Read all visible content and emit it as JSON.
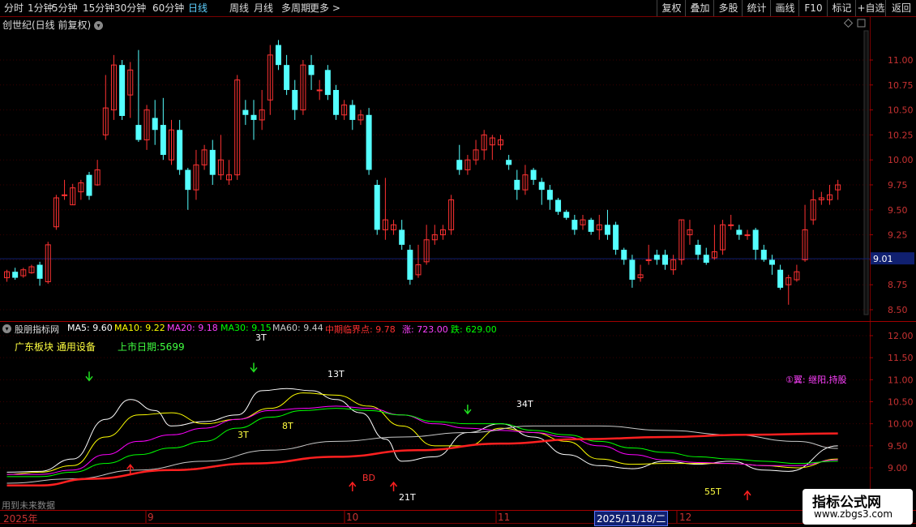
{
  "toolbar": {
    "periods": [
      "分时",
      "1分钟",
      "5分钟",
      "15分钟",
      "30分钟",
      "60分钟",
      "日线",
      "周线",
      "月线",
      "多周期",
      "更多 >"
    ],
    "active_index": 6,
    "right_buttons": [
      "复权",
      "叠加",
      "多股",
      "统计",
      "画线",
      "F10",
      "标记",
      "+自选",
      "返回"
    ]
  },
  "stock": {
    "name": "创世纪(日线 前复权)",
    "toggle_icon": "chevron-down-icon"
  },
  "price_axis": {
    "labels": [
      "11.00",
      "10.75",
      "10.50",
      "10.25",
      "10.00",
      "9.75",
      "9.50",
      "9.25",
      "9.00",
      "8.75",
      "8.50"
    ],
    "current": "9.01"
  },
  "indicator_axis": {
    "labels": [
      "12.00",
      "11.50",
      "11.00",
      "10.50",
      "10.00",
      "9.50",
      "9.00"
    ]
  },
  "indicator": {
    "name": "股朋指标网",
    "ma5": "MA5: 9.60",
    "ma10": "MA10: 9.22",
    "ma20": "MA20: 9.18",
    "ma30": "MA30: 9.15",
    "ma60": "MA60: 9.44",
    "critical": "中期临界点: 9.78",
    "up": "涨: 723.00",
    "down": "跌: 629.00"
  },
  "info": {
    "sector": "广东板块  通用设备",
    "ipo": "上市日期:5699",
    "signal": "①翼: 继阳,持股"
  },
  "chart_labels": {
    "t3a": "3T",
    "t8": "8T",
    "t13": "13T",
    "t34": "34T",
    "t55": "55T",
    "t21": "21T",
    "bd": "BD",
    "t3b": "3T"
  },
  "bottom_note": "用到未来数据",
  "date_axis": {
    "year": "2025年",
    "m9": "9",
    "m10": "10",
    "m11": "11",
    "m12": "12",
    "cursor": "2025/11/18/二"
  },
  "watermark": {
    "title": "指标公式网",
    "url": "www.zbgs3.com"
  },
  "colors": {
    "up": "#ff3232",
    "down": "#54ffff",
    "ma5": "#ffffff",
    "ma10": "#ffff00",
    "ma20": "#ff00ff",
    "ma30": "#00ff00",
    "ma60": "#c8c8c8",
    "critical": "#ff2020"
  },
  "chart_data": {
    "type": "candlestick",
    "price_ylim": [
      8.5,
      11.25
    ],
    "candles": [
      [
        8.82,
        8.88,
        8.78,
        8.9
      ],
      [
        8.88,
        8.82,
        8.8,
        8.92
      ],
      [
        8.84,
        8.9,
        8.82,
        8.92
      ],
      [
        8.87,
        8.93,
        8.86,
        8.95
      ],
      [
        8.95,
        8.81,
        8.74,
        8.98
      ],
      [
        8.78,
        9.15,
        8.76,
        9.18
      ],
      [
        9.33,
        9.62,
        9.3,
        9.65
      ],
      [
        9.65,
        9.65,
        9.6,
        9.8
      ],
      [
        9.55,
        9.72,
        9.55,
        9.76
      ],
      [
        9.68,
        9.77,
        9.6,
        9.8
      ],
      [
        9.85,
        9.64,
        9.6,
        9.88
      ],
      [
        9.75,
        9.9,
        9.74,
        10.0
      ],
      [
        10.25,
        10.52,
        10.2,
        10.85
      ],
      [
        10.5,
        10.95,
        10.4,
        11.05
      ],
      [
        10.95,
        10.44,
        10.4,
        11.0
      ],
      [
        10.65,
        10.9,
        10.42,
        10.98
      ],
      [
        10.35,
        10.2,
        10.18,
        11.1
      ],
      [
        10.2,
        10.5,
        10.1,
        10.55
      ],
      [
        10.42,
        10.3,
        10.15,
        10.6
      ],
      [
        10.35,
        10.05,
        10.0,
        10.62
      ],
      [
        10.0,
        10.3,
        9.95,
        10.4
      ],
      [
        10.3,
        9.9,
        9.85,
        10.4
      ],
      [
        9.9,
        9.7,
        9.5,
        9.92
      ],
      [
        9.7,
        9.95,
        9.6,
        10.1
      ],
      [
        9.95,
        10.1,
        9.9,
        10.15
      ],
      [
        10.1,
        9.85,
        9.75,
        10.2
      ],
      [
        9.85,
        10.0,
        9.8,
        10.25
      ],
      [
        9.8,
        9.85,
        9.75,
        10.0
      ],
      [
        9.85,
        10.8,
        9.8,
        10.85
      ],
      [
        10.5,
        10.45,
        10.35,
        10.6
      ],
      [
        10.45,
        10.4,
        10.2,
        10.6
      ],
      [
        10.4,
        10.5,
        10.3,
        10.7
      ],
      [
        10.6,
        11.05,
        10.45,
        11.15
      ],
      [
        11.15,
        10.95,
        10.9,
        11.2
      ],
      [
        10.95,
        10.7,
        10.65,
        11.05
      ],
      [
        10.7,
        10.5,
        10.4,
        10.8
      ],
      [
        10.5,
        10.95,
        10.45,
        11.0
      ],
      [
        10.95,
        10.85,
        10.7,
        11.05
      ],
      [
        10.7,
        10.7,
        10.6,
        10.8
      ],
      [
        10.9,
        10.65,
        10.6,
        10.95
      ],
      [
        10.7,
        10.45,
        10.4,
        10.75
      ],
      [
        10.45,
        10.55,
        10.4,
        10.6
      ],
      [
        10.55,
        10.4,
        10.3,
        10.6
      ],
      [
        10.4,
        10.45,
        10.35,
        10.5
      ],
      [
        10.45,
        9.9,
        9.85,
        10.52
      ],
      [
        9.75,
        9.3,
        9.25,
        9.8
      ],
      [
        9.3,
        9.4,
        9.2,
        9.82
      ],
      [
        9.3,
        9.35,
        9.25,
        9.4
      ],
      [
        9.3,
        9.15,
        9.1,
        9.4
      ],
      [
        9.1,
        8.8,
        8.75,
        9.15
      ],
      [
        8.85,
        8.95,
        8.82,
        9.15
      ],
      [
        8.98,
        9.2,
        8.95,
        9.35
      ],
      [
        9.2,
        9.25,
        9.15,
        9.35
      ],
      [
        9.25,
        9.3,
        9.2,
        9.35
      ],
      [
        9.3,
        9.6,
        9.25,
        9.65
      ],
      [
        10.0,
        9.9,
        9.85,
        10.15
      ],
      [
        9.9,
        10.0,
        9.85,
        10.05
      ],
      [
        10.0,
        10.1,
        9.95,
        10.2
      ],
      [
        10.1,
        10.25,
        10.0,
        10.3
      ],
      [
        10.15,
        10.22,
        10.0,
        10.25
      ],
      [
        10.15,
        10.2,
        10.1,
        10.25
      ],
      [
        10.0,
        9.95,
        9.9,
        10.05
      ],
      [
        9.8,
        9.7,
        9.6,
        9.9
      ],
      [
        9.7,
        9.85,
        9.65,
        9.95
      ],
      [
        9.9,
        9.8,
        9.75,
        9.92
      ],
      [
        9.78,
        9.7,
        9.55,
        9.82
      ],
      [
        9.7,
        9.6,
        9.5,
        9.75
      ],
      [
        9.6,
        9.48,
        9.45,
        9.62
      ],
      [
        9.48,
        9.42,
        9.4,
        9.5
      ],
      [
        9.4,
        9.3,
        9.25,
        9.45
      ],
      [
        9.35,
        9.4,
        9.3,
        9.45
      ],
      [
        9.4,
        9.28,
        9.25,
        9.42
      ],
      [
        9.3,
        9.35,
        9.2,
        9.45
      ],
      [
        9.35,
        9.25,
        9.2,
        9.5
      ],
      [
        9.35,
        9.1,
        9.05,
        9.38
      ],
      [
        9.1,
        9.0,
        8.95,
        9.12
      ],
      [
        9.0,
        8.8,
        8.72,
        9.05
      ],
      [
        8.82,
        8.85,
        8.78,
        8.95
      ],
      [
        9.0,
        9.0,
        8.95,
        9.15
      ],
      [
        9.05,
        9.0,
        8.95,
        9.1
      ],
      [
        9.05,
        8.95,
        8.9,
        9.1
      ],
      [
        8.9,
        9.0,
        8.85,
        9.05
      ],
      [
        9.0,
        9.4,
        8.95,
        9.4
      ],
      [
        9.25,
        9.3,
        9.15,
        9.4
      ],
      [
        9.15,
        9.05,
        9.0,
        9.2
      ],
      [
        9.05,
        8.97,
        8.95,
        9.12
      ],
      [
        9.02,
        9.08,
        9.0,
        9.35
      ],
      [
        9.1,
        9.35,
        9.05,
        9.4
      ],
      [
        9.35,
        9.35,
        9.3,
        9.45
      ],
      [
        9.3,
        9.25,
        9.2,
        9.35
      ],
      [
        9.25,
        9.25,
        9.2,
        9.3
      ],
      [
        9.3,
        9.1,
        9.0,
        9.32
      ],
      [
        9.1,
        9.0,
        8.98,
        9.15
      ],
      [
        9.0,
        8.95,
        8.85,
        9.05
      ],
      [
        8.9,
        8.72,
        8.7,
        8.95
      ],
      [
        8.75,
        8.82,
        8.55,
        8.85
      ],
      [
        8.8,
        8.88,
        8.78,
        8.95
      ],
      [
        9.0,
        9.3,
        8.98,
        9.55
      ],
      [
        9.4,
        9.6,
        9.35,
        9.7
      ],
      [
        9.6,
        9.62,
        9.55,
        9.68
      ],
      [
        9.6,
        9.65,
        9.55,
        9.75
      ],
      [
        9.7,
        9.75,
        9.6,
        9.8
      ]
    ],
    "indicator_ylim": [
      8.5,
      12.25
    ],
    "series": [
      {
        "name": "MA5",
        "x": [
          0,
          4,
          8,
          12,
          15,
          18,
          20,
          24,
          28,
          31,
          34,
          37,
          40,
          43,
          46,
          48,
          52,
          56,
          60,
          64,
          68,
          72,
          76,
          80,
          84,
          88,
          92,
          95,
          101
        ],
        "values": [
          8.9,
          8.92,
          9.2,
          10.1,
          10.55,
          10.3,
          9.95,
          10.05,
          10.2,
          10.75,
          10.8,
          10.75,
          10.55,
          10.25,
          9.65,
          9.15,
          9.25,
          9.8,
          10.0,
          9.7,
          9.3,
          9.05,
          8.98,
          9.15,
          9.08,
          9.15,
          8.95,
          8.92,
          9.5
        ]
      },
      {
        "name": "MA10",
        "x": [
          0,
          4,
          8,
          12,
          16,
          20,
          24,
          28,
          32,
          36,
          40,
          44,
          48,
          52,
          56,
          60,
          64,
          68,
          72,
          76,
          80,
          84,
          88,
          92,
          96,
          101
        ],
        "values": [
          8.85,
          8.9,
          9.05,
          9.7,
          10.2,
          10.25,
          10.0,
          10.1,
          10.35,
          10.7,
          10.65,
          10.4,
          9.95,
          9.5,
          9.5,
          9.9,
          9.8,
          9.6,
          9.2,
          9.08,
          9.1,
          9.1,
          9.1,
          9.05,
          9.0,
          9.2
        ]
      },
      {
        "name": "MA20",
        "x": [
          0,
          4,
          8,
          12,
          16,
          20,
          24,
          28,
          32,
          36,
          40,
          44,
          48,
          52,
          56,
          60,
          64,
          68,
          72,
          76,
          80,
          84,
          88,
          92,
          96,
          101
        ],
        "values": [
          8.85,
          8.85,
          8.95,
          9.3,
          9.6,
          9.75,
          9.9,
          10.1,
          10.3,
          10.35,
          10.4,
          10.35,
          10.2,
          10.0,
          9.9,
          9.85,
          9.8,
          9.7,
          9.5,
          9.3,
          9.18,
          9.12,
          9.1,
          9.05,
          9.05,
          9.18
        ]
      },
      {
        "name": "MA30",
        "x": [
          0,
          4,
          8,
          12,
          16,
          20,
          24,
          28,
          32,
          36,
          40,
          44,
          48,
          52,
          56,
          60,
          64,
          68,
          72,
          76,
          80,
          84,
          88,
          92,
          96,
          101
        ],
        "values": [
          8.8,
          8.8,
          8.9,
          9.1,
          9.3,
          9.45,
          9.6,
          9.9,
          10.15,
          10.3,
          10.35,
          10.3,
          10.2,
          10.05,
          10.0,
          10.0,
          9.85,
          9.75,
          9.6,
          9.45,
          9.35,
          9.25,
          9.2,
          9.15,
          9.1,
          9.15
        ]
      },
      {
        "name": "MA60",
        "x": [
          0,
          8,
          16,
          24,
          32,
          40,
          48,
          56,
          64,
          72,
          80,
          88,
          96,
          101
        ],
        "values": [
          8.65,
          8.75,
          8.95,
          9.15,
          9.4,
          9.6,
          9.7,
          9.8,
          9.95,
          9.95,
          9.85,
          9.75,
          9.6,
          9.44
        ]
      },
      {
        "name": "中期临界点",
        "x": [
          0,
          4,
          10,
          20,
          30,
          40,
          50,
          60,
          70,
          80,
          90,
          101
        ],
        "values": [
          8.6,
          8.6,
          8.75,
          8.95,
          9.1,
          9.25,
          9.4,
          9.55,
          9.65,
          9.7,
          9.75,
          9.78
        ]
      }
    ],
    "arrows_down": [
      {
        "x": 10,
        "y": 11.0
      },
      {
        "x": 30,
        "y": 11.2
      },
      {
        "x": 56,
        "y": 10.25
      }
    ],
    "arrows_up": [
      {
        "x": 15,
        "y": 9.05
      },
      {
        "x": 42,
        "y": 8.65
      },
      {
        "x": 47,
        "y": 8.65
      },
      {
        "x": 90,
        "y": 8.45
      }
    ]
  }
}
